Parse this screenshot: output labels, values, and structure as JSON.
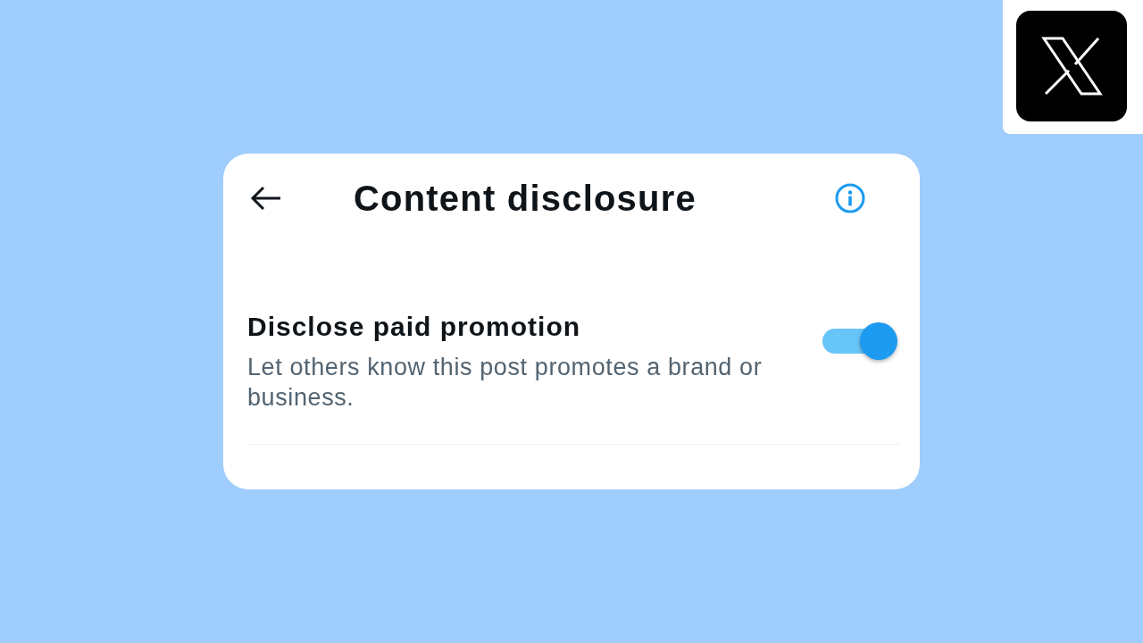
{
  "header": {
    "title": "Content disclosure"
  },
  "settings": [
    {
      "title": "Disclose paid promotion",
      "description": "Let others know this post promotes a brand or business.",
      "on": true
    }
  ]
}
